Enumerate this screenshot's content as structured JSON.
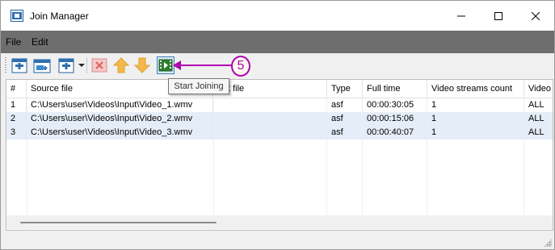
{
  "window": {
    "title": "Join Manager"
  },
  "menu": {
    "file": "File",
    "edit": "Edit"
  },
  "toolbar": {
    "tooltip": "Start Joining"
  },
  "callout": {
    "number": "5",
    "color": "#b000b0"
  },
  "grid": {
    "columns": [
      "#",
      "Source file",
      "t file",
      "Type",
      "Full time",
      "Video streams count",
      "Video s"
    ],
    "rows": [
      [
        "1",
        "C:\\Users\\user\\Videos\\Input\\Video_1.wmv",
        "",
        "asf",
        "00:00:30:05",
        "1",
        "ALL"
      ],
      [
        "2",
        "C:\\Users\\user\\Videos\\Input\\Video_2.wmv",
        "",
        "asf",
        "00:00:15:06",
        "1",
        "ALL"
      ],
      [
        "3",
        "C:\\Users\\user\\Videos\\Input\\Video_3.wmv",
        "",
        "asf",
        "00:00:40:07",
        "1",
        "ALL"
      ]
    ]
  }
}
